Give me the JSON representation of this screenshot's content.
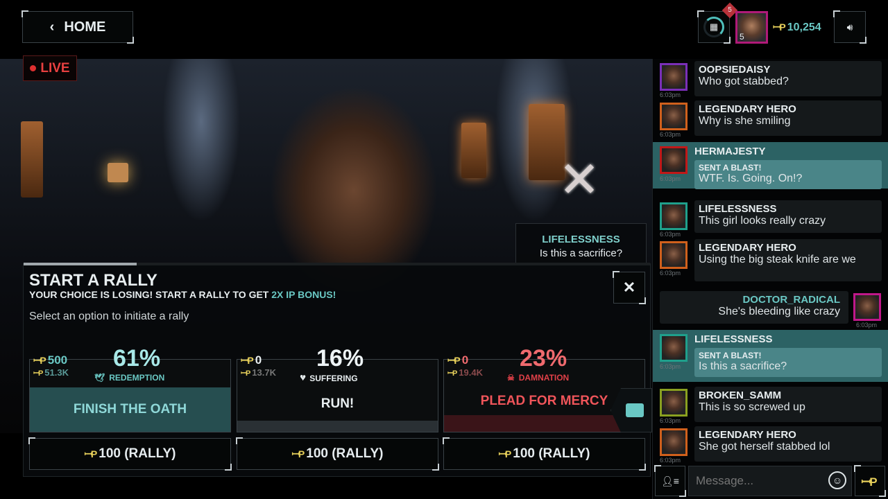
{
  "header": {
    "home_label": "HOME",
    "gift_badge": "5",
    "avatar_level": "5",
    "ip_balance": "10,254",
    "ip_symbol": "ꟷP"
  },
  "video": {
    "live_label": "LIVE",
    "reaction": {
      "user": "LIFELESSNESS",
      "text": "Is this a sacrifice?",
      "icon": "crossed-knife-icon"
    }
  },
  "rally": {
    "title": "START A RALLY",
    "subtitle_prefix": "YOUR CHOICE IS LOSING! START A RALLY TO GET ",
    "subtitle_highlight": "2X IP BONUS!",
    "instruction": "Select an option to initiate a rally",
    "progress": 0.18,
    "options": [
      {
        "ip": "500",
        "ip_total": "51.3K",
        "percent": "61%",
        "category": "REDEMPTION",
        "icon": "dove-icon",
        "label": "FINISH THE OATH",
        "rally_cost": "100 (RALLY)",
        "color": "#8fd8d8",
        "selected": true
      },
      {
        "ip": "0",
        "ip_total": "13.7K",
        "percent": "16%",
        "category": "SUFFERING",
        "icon": "broken-heart-icon",
        "label": "RUN!",
        "rally_cost": "100 (RALLY)",
        "color": "#e8eef0"
      },
      {
        "ip": "0",
        "ip_total": "19.4K",
        "percent": "23%",
        "category": "DAMNATION",
        "icon": "skull-icon",
        "label": "PLEAD FOR MERCY",
        "rally_cost": "100 (RALLY)",
        "color": "#f0555a"
      }
    ]
  },
  "chat": {
    "messages": [
      {
        "user": "OOPSIEDAISY",
        "text": "Who got stabbed?",
        "time": "6:03pm",
        "frame": "#7a2fb8"
      },
      {
        "user": "LEGENDARY HERO",
        "text": "Why is she smiling",
        "time": "6:03pm",
        "frame": "#d0601c"
      },
      {
        "user": "HERMAJESTY",
        "blast": "SENT A BLAST!",
        "text": "WTF. Is. Going. On!?",
        "time": "6:03pm",
        "frame": "#c01818"
      },
      {
        "user": "LIFELESSNESS",
        "text": "This girl looks really crazy",
        "time": "6:03pm",
        "frame": "#1fa08c"
      },
      {
        "user": "LEGENDARY HERO",
        "text": "Using the big steak knife are we",
        "time": "6:03pm",
        "frame": "#d0601c"
      },
      {
        "user": "DOCTOR_RADICAL",
        "text": "She's bleeding like crazy",
        "time": "6:03pm",
        "frame": "#c0188a"
      },
      {
        "user": "LIFELESSNESS",
        "blast": "SENT A BLAST!",
        "text": "Is this a sacrifice?",
        "time": "6:03pm",
        "frame": "#1fa08c"
      },
      {
        "user": "BROKEN_SAMM",
        "text": "This is so screwed up",
        "time": "6:03pm",
        "frame": "#8aa020"
      },
      {
        "user": "LEGENDARY HERO",
        "text": "She got herself stabbed lol",
        "time": "6:03pm",
        "frame": "#d0601c"
      }
    ],
    "input_placeholder": "Message..."
  }
}
